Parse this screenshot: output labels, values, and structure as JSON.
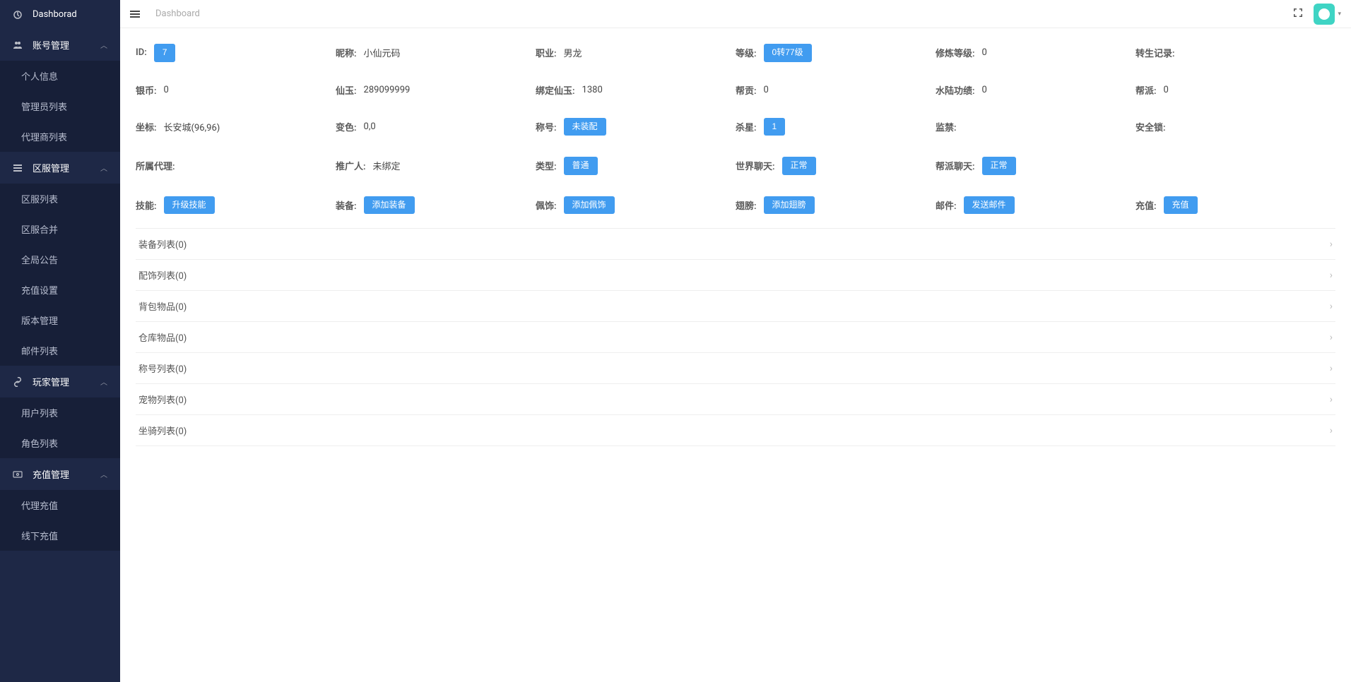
{
  "breadcrumb": "Dashboard",
  "sidebar": {
    "dashboard": "Dashborad",
    "groups": [
      {
        "label": "账号管理",
        "items": [
          "个人信息",
          "管理员列表",
          "代理商列表"
        ]
      },
      {
        "label": "区服管理",
        "items": [
          "区服列表",
          "区服合并",
          "全局公告",
          "充值设置",
          "版本管理",
          "邮件列表"
        ]
      },
      {
        "label": "玩家管理",
        "items": [
          "用户列表",
          "角色列表"
        ]
      },
      {
        "label": "充值管理",
        "items": [
          "代理充值",
          "线下充值"
        ]
      }
    ]
  },
  "info": {
    "row1": {
      "id_label": "ID:",
      "id_btn": "7",
      "nick_label": "昵称:",
      "nick_val": "小仙元码",
      "job_label": "职业:",
      "job_val": "男龙",
      "level_label": "等级:",
      "level_btn": "0转77级",
      "xiulian_label": "修炼等级:",
      "xiulian_val": "0",
      "rebirth_label": "转生记录:"
    },
    "row2": {
      "silver_label": "银币:",
      "silver_val": "0",
      "xianyu_label": "仙玉:",
      "xianyu_val": "289099999",
      "bdxy_label": "绑定仙玉:",
      "bdxy_val": "1380",
      "banggong_label": "帮贡:",
      "banggong_val": "0",
      "shuilu_label": "水陆功绩:",
      "shuilu_val": "0",
      "bangpai_label": "帮派:",
      "bangpai_val": "0"
    },
    "row3": {
      "coord_label": "坐标:",
      "coord_val": "长安城(96,96)",
      "color_label": "变色:",
      "color_val": "0,0",
      "title_label": "称号:",
      "title_btn": "未装配",
      "kill_label": "杀星:",
      "kill_btn": "1",
      "jail_label": "监禁:",
      "lock_label": "安全锁:"
    },
    "row4": {
      "agent_label": "所属代理:",
      "promo_label": "推广人:",
      "promo_val": "未绑定",
      "type_label": "类型:",
      "type_btn": "普通",
      "world_label": "世界聊天:",
      "world_btn": "正常",
      "guild_label": "帮派聊天:",
      "guild_btn": "正常"
    },
    "row5": {
      "skill_label": "技能:",
      "skill_btn": "升级技能",
      "equip_label": "装备:",
      "equip_btn": "添加装备",
      "deco_label": "佩饰:",
      "deco_btn": "添加佩饰",
      "wing_label": "翅膀:",
      "wing_btn": "添加翅膀",
      "mail_label": "邮件:",
      "mail_btn": "发送邮件",
      "charge_label": "充值:",
      "charge_btn": "充值"
    }
  },
  "accordion": [
    "装备列表(0)",
    "配饰列表(0)",
    "背包物品(0)",
    "仓库物品(0)",
    "称号列表(0)",
    "宠物列表(0)",
    "坐骑列表(0)"
  ]
}
